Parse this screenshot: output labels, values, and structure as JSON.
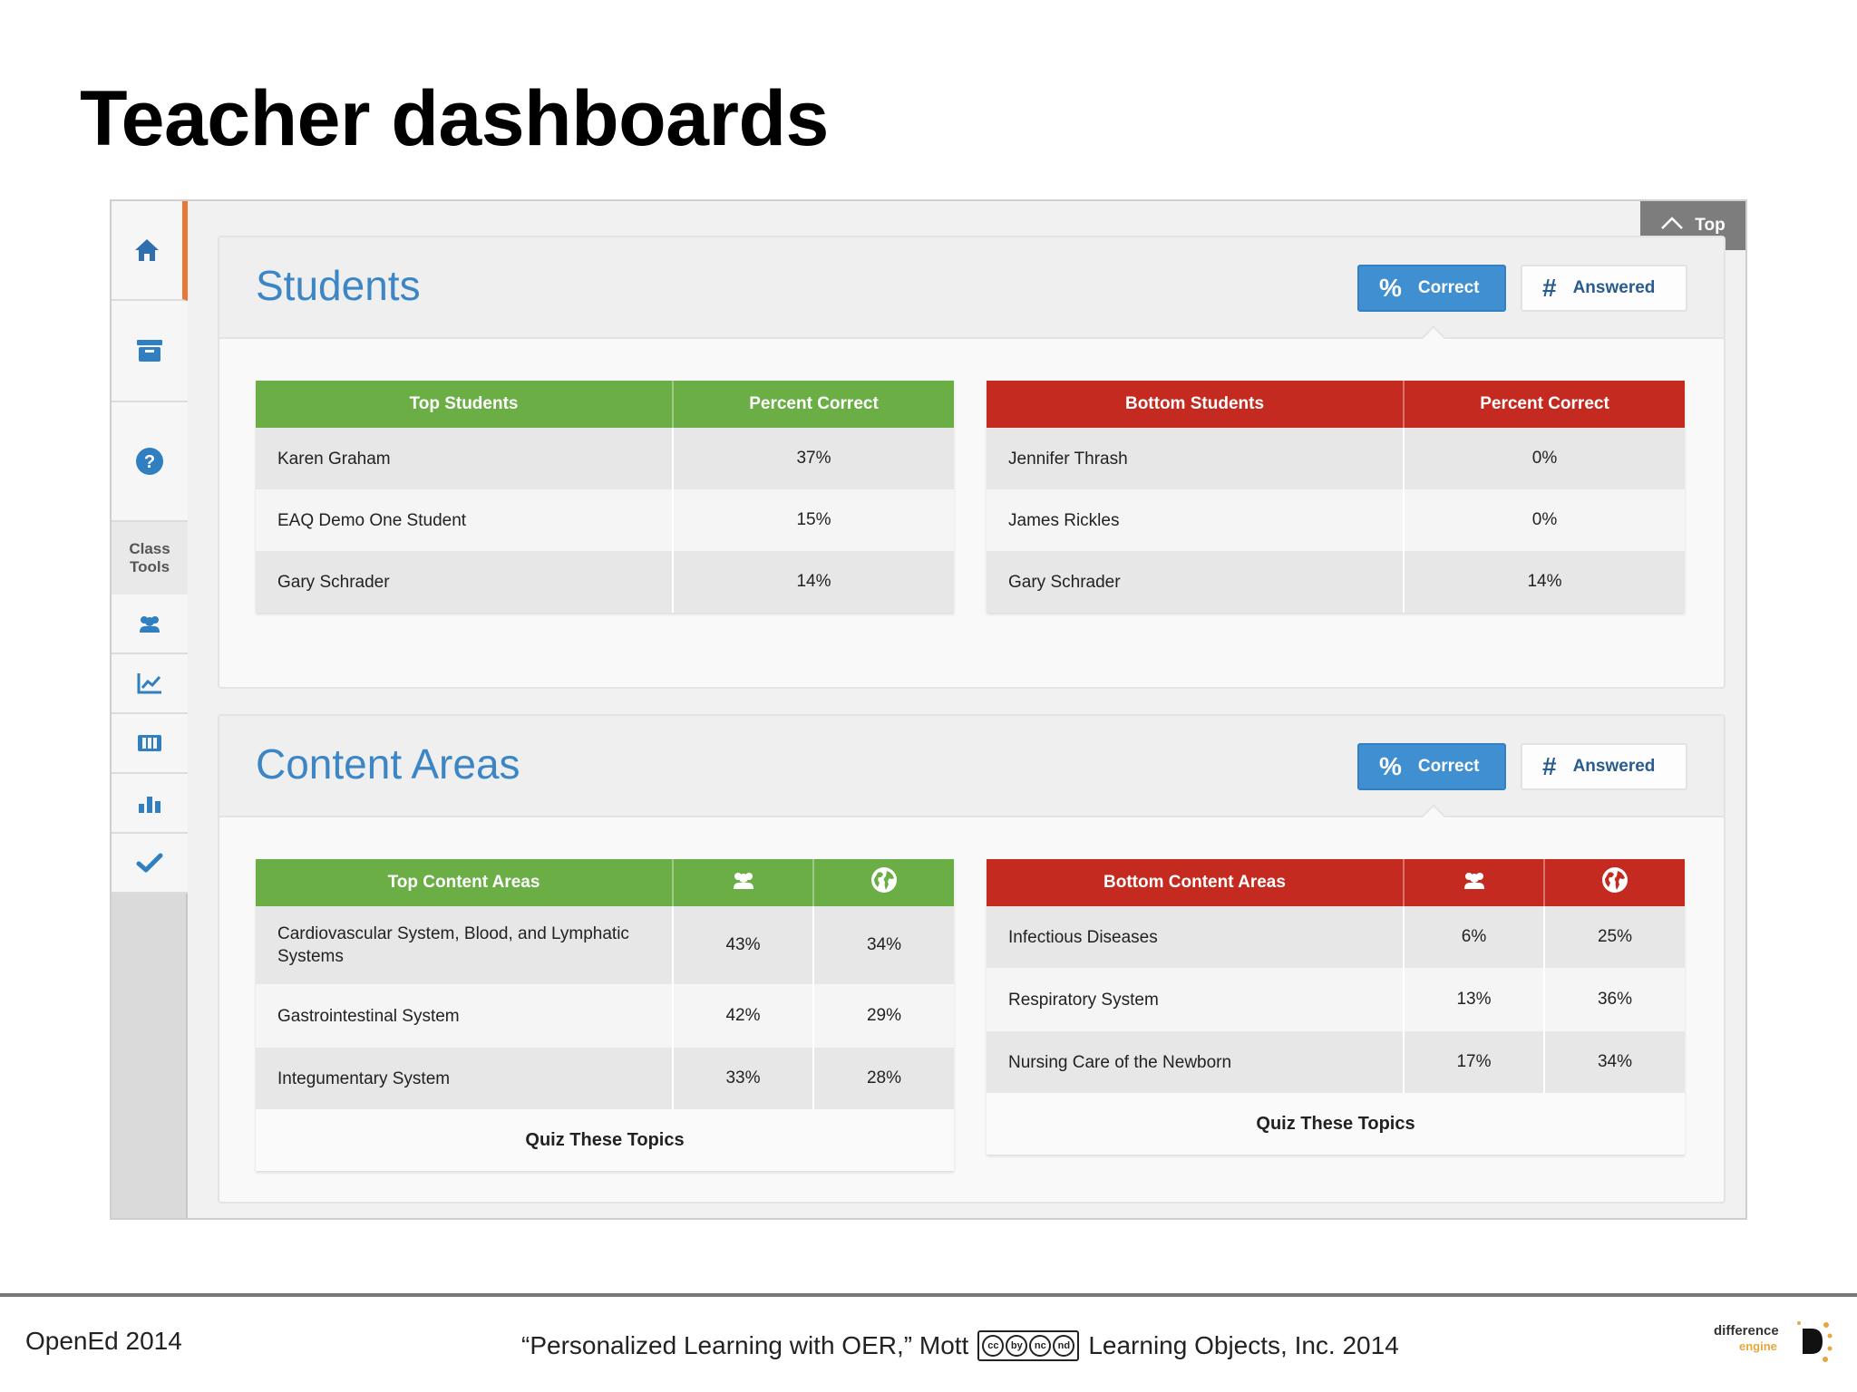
{
  "slide": {
    "title": "Teacher dashboards"
  },
  "sidebar": {
    "items": [
      {
        "icon": "home-icon"
      },
      {
        "icon": "inbox-icon"
      },
      {
        "icon": "help-icon"
      }
    ],
    "class_tools_label_1": "Class",
    "class_tools_label_2": "Tools",
    "tools": [
      {
        "icon": "students-icon"
      },
      {
        "icon": "line-chart-icon"
      },
      {
        "icon": "book-icon"
      },
      {
        "icon": "bar-chart-icon"
      },
      {
        "icon": "checkmark-icon"
      }
    ],
    "accent_color": "#e8773a",
    "icon_color": "#2f7fc1"
  },
  "top_button": {
    "label": "Top"
  },
  "students": {
    "title": "Students",
    "correct_label": "Correct",
    "answered_label": "Answered",
    "top": {
      "headers": [
        "Top Students",
        "Percent Correct"
      ],
      "rows": [
        {
          "name": "Karen Graham",
          "pct": "37%"
        },
        {
          "name": "EAQ Demo One Student",
          "pct": "15%"
        },
        {
          "name": "Gary Schrader",
          "pct": "14%"
        }
      ]
    },
    "bottom": {
      "headers": [
        "Bottom Students",
        "Percent Correct"
      ],
      "rows": [
        {
          "name": "Jennifer Thrash",
          "pct": "0%"
        },
        {
          "name": "James Rickles",
          "pct": "0%"
        },
        {
          "name": "Gary Schrader",
          "pct": "14%"
        }
      ]
    }
  },
  "content_areas": {
    "title": "Content Areas",
    "correct_label": "Correct",
    "answered_label": "Answered",
    "top": {
      "header": "Top Content Areas",
      "rows": [
        {
          "name": "Cardiovascular System, Blood, and Lymphatic Systems",
          "class_pct": "43%",
          "global_pct": "34%"
        },
        {
          "name": "Gastrointestinal System",
          "class_pct": "42%",
          "global_pct": "29%"
        },
        {
          "name": "Integumentary System",
          "class_pct": "33%",
          "global_pct": "28%"
        }
      ],
      "link": "Quiz These Topics"
    },
    "bottom": {
      "header": "Bottom Content Areas",
      "rows": [
        {
          "name": "Infectious Diseases",
          "class_pct": "6%",
          "global_pct": "25%"
        },
        {
          "name": "Respiratory System",
          "class_pct": "13%",
          "global_pct": "36%"
        },
        {
          "name": "Nursing Care of the Newborn",
          "class_pct": "17%",
          "global_pct": "34%"
        }
      ],
      "link": "Quiz These Topics"
    }
  },
  "colors": {
    "green": "#6aae45",
    "red": "#c42a20",
    "blue": "#3f8fd1",
    "title_blue": "#3d86c6"
  },
  "footer": {
    "left": "OpenEd 2014",
    "citation": "“Personalized Learning with OER,” Mott",
    "license_badge": [
      "cc",
      "by",
      "nc",
      "nd"
    ],
    "org": "Learning Objects, Inc. 2014",
    "logo_line1": "difference",
    "logo_line2": "engine"
  }
}
